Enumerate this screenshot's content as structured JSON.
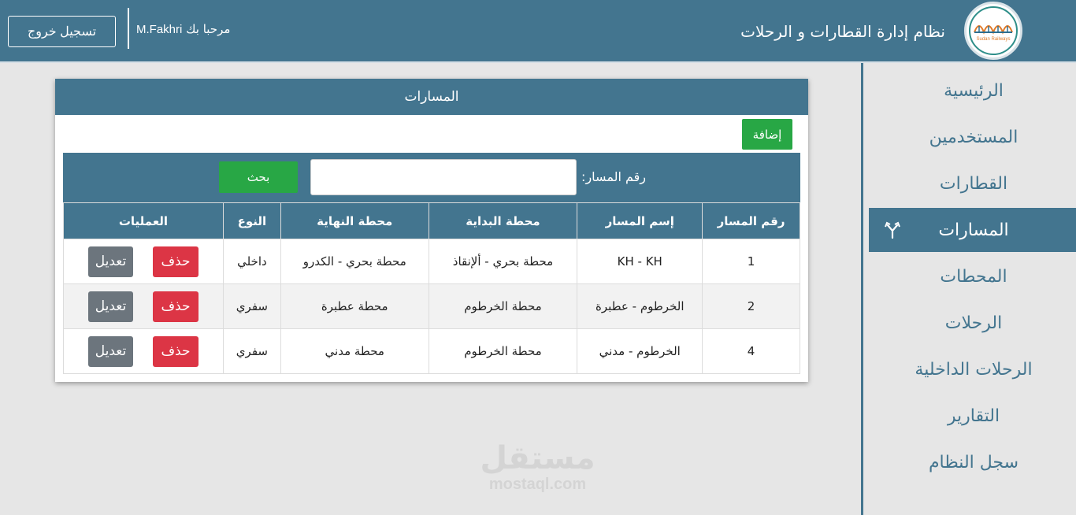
{
  "header": {
    "title": "نظام إدارة القطارات و الرحلات",
    "welcome_text": "مرحبا بك",
    "username": "M.Fakhri",
    "logout_label": "تسجيل خروج",
    "logo_text": "Sudan Railways"
  },
  "sidebar": {
    "items": [
      {
        "label": "الرئيسية"
      },
      {
        "label": "المستخدمين"
      },
      {
        "label": "القطارات"
      },
      {
        "label": "المسارات",
        "active": true,
        "icon": "route-split-icon"
      },
      {
        "label": "المحطات"
      },
      {
        "label": "الرحلات"
      },
      {
        "label": "الرحلات الداخلية"
      },
      {
        "label": "التقارير"
      },
      {
        "label": "سجل النظام"
      }
    ]
  },
  "panel": {
    "title": "المسارات",
    "add_label": "إضافة",
    "search": {
      "label": "رقم المسار:",
      "value": "",
      "placeholder": "",
      "button_label": "بحث"
    },
    "table": {
      "headers": [
        "رقم المسار",
        "إسم المسار",
        "محطة البداية",
        "محطة النهاية",
        "النوع",
        "العمليات"
      ],
      "rows": [
        {
          "id": "1",
          "name": "KH - KH",
          "start": "محطة بحري - ألإنقاذ",
          "end": "محطة بحري - الكدرو",
          "type": "داخلي"
        },
        {
          "id": "2",
          "name": "الخرطوم - عطبرة",
          "start": "محطة الخرطوم",
          "end": "محطة عطبرة",
          "type": "سفري"
        },
        {
          "id": "4",
          "name": "الخرطوم - مدني",
          "start": "محطة الخرطوم",
          "end": "محطة مدني",
          "type": "سفري"
        }
      ],
      "edit_label": "تعديل",
      "delete_label": "حذف"
    }
  },
  "watermark": {
    "arabic": "مستقل",
    "latin": "mostaql.com"
  },
  "colors": {
    "primary": "#43758f",
    "success": "#28a745",
    "danger": "#dc3545",
    "secondary": "#6c757d",
    "background": "#e6e6e6"
  }
}
